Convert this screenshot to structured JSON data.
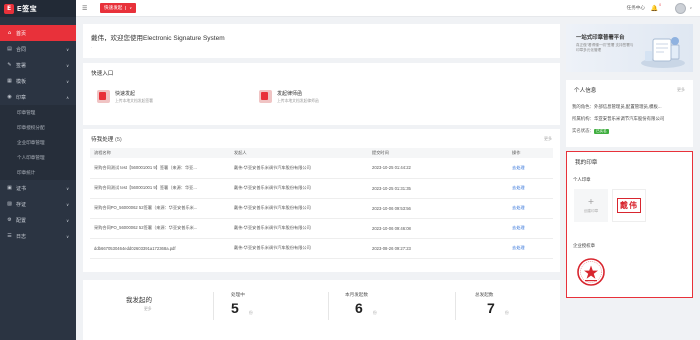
{
  "app": {
    "logo_mark": "E",
    "logo_text": "E签宝"
  },
  "sidebar": {
    "items": [
      {
        "label": "首页",
        "icon": "home-icon",
        "glyph": "⌂",
        "active": true
      },
      {
        "label": "合同",
        "icon": "contract-icon",
        "glyph": "▤",
        "chevron": "∨"
      },
      {
        "label": "签署",
        "icon": "sign-icon",
        "glyph": "✎",
        "chevron": "∨"
      },
      {
        "label": "模板",
        "icon": "template-icon",
        "glyph": "▦",
        "chevron": "∨"
      },
      {
        "label": "印章",
        "icon": "seal-icon",
        "glyph": "◉",
        "chevron": "∧"
      }
    ],
    "sub_items": [
      "印章管理",
      "印章授权分配",
      "企业印章管理",
      "个人印章管理",
      "印章统计"
    ],
    "bottom_items": [
      {
        "label": "证书",
        "icon": "certificate-icon",
        "glyph": "▣",
        "chevron": "∨"
      },
      {
        "label": "存证",
        "icon": "evidence-icon",
        "glyph": "▨",
        "chevron": "∨"
      },
      {
        "label": "配置",
        "icon": "config-icon",
        "glyph": "⚙",
        "chevron": "∨"
      },
      {
        "label": "日志",
        "icon": "log-icon",
        "glyph": "☰",
        "chevron": "∨"
      }
    ]
  },
  "topbar": {
    "menu_glyph": "☰",
    "quick_label": "快速发起",
    "caret": "∨",
    "task_center": "任务中心",
    "bell_glyph": "🔔",
    "bell_count": "0"
  },
  "welcome": {
    "title": "戴伟，欢迎您使用Electronic Signature System",
    "dot": "."
  },
  "quick_entry": {
    "title": "快速入口",
    "items": [
      {
        "label": "快速发起",
        "desc": "上传本地文档发起签署"
      },
      {
        "label": "发起律师函",
        "desc": "上传本地文档发起律师函"
      }
    ]
  },
  "todo": {
    "title": "待我处理",
    "count": "(5)",
    "more": "更多",
    "columns": [
      "流程名称",
      "发起人",
      "提交时间",
      "操作"
    ],
    "rows": [
      [
        "采购合同测试 test【560001001 9】签署（来源：华亚...",
        "戴伟-华亚安普乐米调节汽车股份有限公司",
        "2023-10-25 01:44:22",
        "去处理"
      ],
      [
        "采购合同测试 test【560001001 9】签署（来源：华亚...",
        "戴伟-华亚安普乐米调节汽车股份有限公司",
        "2023-10-25 01:31:35",
        "去处理"
      ],
      [
        "采购合同PO_56000062 52签署（来源：华亚安普乐米...",
        "戴伟-华亚安普乐米调节汽车股份有限公司",
        "2023-10-06 09:53:56",
        "去处理"
      ],
      [
        "采购合同PO_56000062 52签署（来源：华亚安普乐米...",
        "戴伟-华亚安普乐米调节汽车股份有限公司",
        "2023-10-06 09:46:08",
        "去处理"
      ],
      [
        "ddb6670530464edd02603391a172368a.pdf",
        "戴伟-华亚安普乐米调节汽车股份有限公司",
        "2023-08-26 09:27:23",
        "去处理"
      ]
    ]
  },
  "stats": {
    "title": "我发起的",
    "sub": "更多",
    "items": [
      {
        "label": "处理中",
        "value": "5",
        "unit": "份"
      },
      {
        "label": "本月发起数",
        "value": "6",
        "unit": "份"
      },
      {
        "label": "总发起数",
        "value": "7",
        "unit": "份"
      }
    ]
  },
  "promo": {
    "title": "一站式印章普署平台",
    "desc": "真正做\"看得懂一切\"签署 支持签署与印章多元化管理"
  },
  "personal": {
    "title": "个人信息",
    "more": "更多",
    "rows": [
      {
        "k": "我的角色：",
        "v": "外部信息管理员,配置管理员,模板..."
      },
      {
        "k": "所属机构：",
        "v": "华亚安普乐米调节汽车股份有限公司"
      },
      {
        "k": "实名状态：",
        "v": "",
        "badge": "已实名"
      }
    ]
  },
  "seals": {
    "title": "我的印章",
    "personal_label": "个人印章",
    "add_label": "创建印章",
    "add_glyph": "+",
    "personal_seal_text": "戴伟",
    "company_label": "企业授权章"
  },
  "colors": {
    "accent": "#e8313a",
    "sidebar": "#2b3442",
    "link": "#2d6fd8",
    "success": "#3fae3f"
  }
}
